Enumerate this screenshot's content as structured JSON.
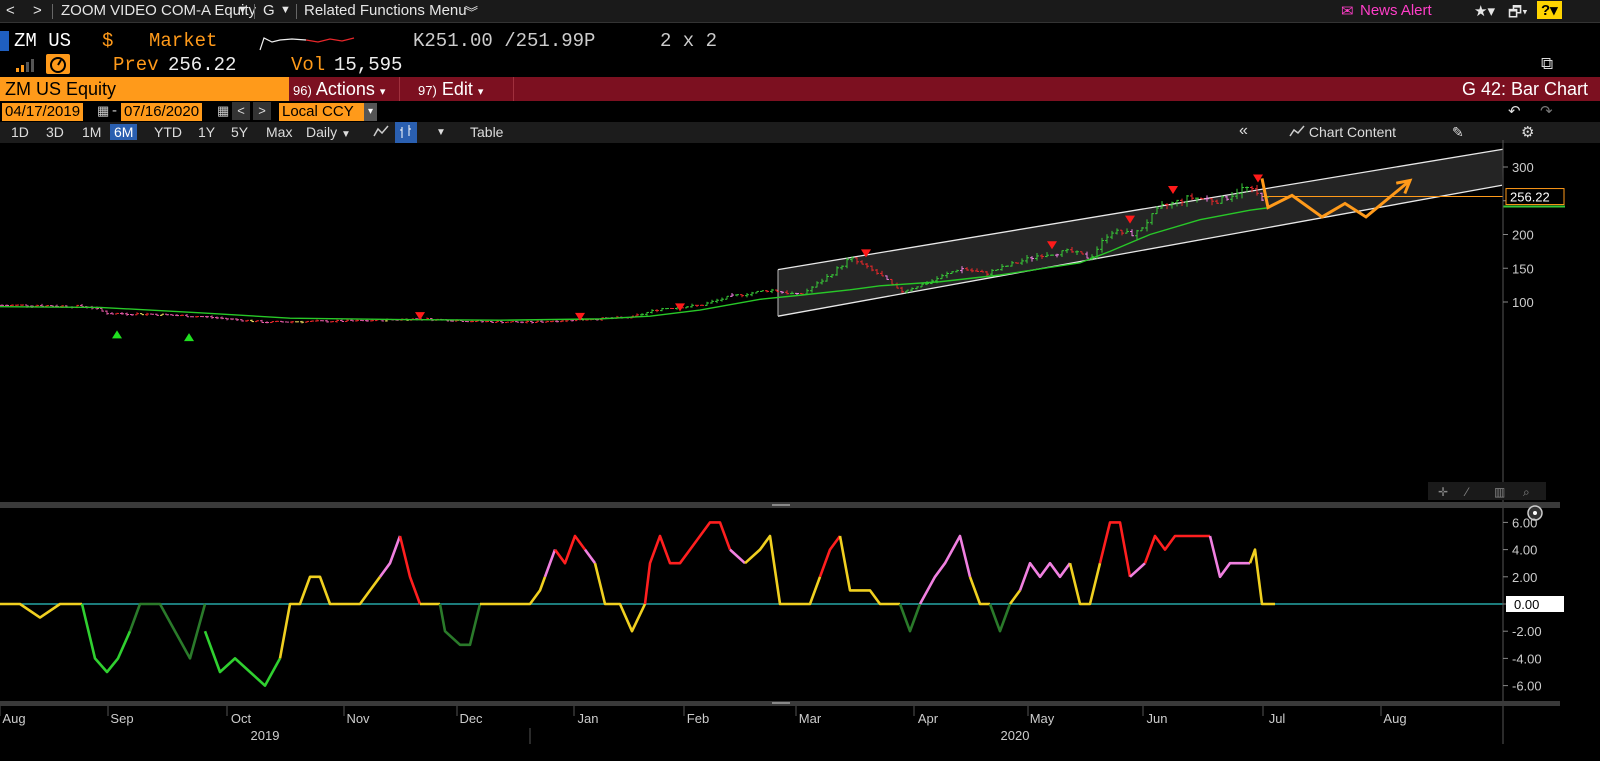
{
  "nav": {
    "back_glyph": "<",
    "forward_glyph": ">",
    "security": "ZOOM VIDEO COM-A Equity",
    "function": "G",
    "related": "Related Functions Menu",
    "news_alert": "News Alert"
  },
  "quote": {
    "ticker": "ZM US",
    "currency": "$",
    "mode": "Market",
    "bid_ask": "K251.00 /251.99P",
    "size": "2 x 2",
    "prev_label": "Prev",
    "prev_value": "256.22",
    "vol_label": "Vol",
    "vol_value": "15,595"
  },
  "command": {
    "security": "ZM US Equity",
    "actions_num": "96)",
    "actions": "Actions",
    "edit_num": "97)",
    "edit": "Edit",
    "chart_name": "G 42: Bar Chart"
  },
  "dates": {
    "start": "04/17/2019",
    "dash": "-",
    "end": "07/16/2020",
    "ccy": "Local CCY"
  },
  "toolbar": {
    "periods": [
      "1D",
      "3D",
      "1M",
      "6M",
      "YTD",
      "1Y",
      "5Y",
      "Max"
    ],
    "selected_period": "6M",
    "frequency": "Daily",
    "table": "Table",
    "chart_content": "Chart Content"
  },
  "icons": {
    "star": "star-icon",
    "alert": "bell-icon",
    "help": "help-icon",
    "gauge": "gauge-icon",
    "signal": "signal-icon",
    "undo": "undo-icon",
    "redo": "redo-icon",
    "settings": "gear-icon",
    "edit": "pencil-icon",
    "collapse": "chevron-double-left-icon",
    "expand": "expand-icon"
  },
  "colors": {
    "accent": "#ff9a1a",
    "command_bar": "#7c1020",
    "price_up": "#37c837",
    "price_down": "#e8272a",
    "ma_line": "#28c828",
    "osc_red": "#ff1f1f",
    "osc_yellow": "#f0d020",
    "osc_pink": "#f080e0",
    "osc_green": "#30d030",
    "osc_dark_green": "#2a7a2a",
    "zero_line": "#2ec5c5",
    "projection": "#ff9a1a"
  },
  "chart_data": [
    {
      "type": "bar",
      "title": "",
      "last_price": 256.22,
      "y_ticks": [
        100,
        150,
        200,
        250,
        300
      ],
      "y_tick_labels": [
        "100",
        "150",
        "200",
        "300"
      ],
      "ylim": [
        54,
        310
      ],
      "x_month_labels": [
        "Aug",
        "Sep",
        "Oct",
        "Nov",
        "Dec",
        "Jan",
        "Feb",
        "Mar",
        "Apr",
        "May",
        "Jun",
        "Jul",
        "Aug"
      ],
      "x_year_labels": [
        "2019",
        "2020"
      ],
      "price_path": [
        [
          0,
          95
        ],
        [
          35,
          95
        ],
        [
          60,
          94
        ],
        [
          90,
          93
        ],
        [
          108,
          83
        ],
        [
          150,
          82
        ],
        [
          205,
          78
        ],
        [
          265,
          70
        ],
        [
          300,
          71
        ],
        [
          360,
          72
        ],
        [
          420,
          75
        ],
        [
          480,
          71
        ],
        [
          530,
          70
        ],
        [
          580,
          74
        ],
        [
          630,
          77
        ],
        [
          660,
          90
        ],
        [
          700,
          95
        ],
        [
          730,
          108
        ],
        [
          770,
          118
        ],
        [
          800,
          110
        ],
        [
          830,
          140
        ],
        [
          850,
          165
        ],
        [
          880,
          140
        ],
        [
          900,
          115
        ],
        [
          930,
          130
        ],
        [
          960,
          150
        ],
        [
          985,
          142
        ],
        [
          1010,
          155
        ],
        [
          1040,
          170
        ],
        [
          1070,
          175
        ],
        [
          1090,
          165
        ],
        [
          1110,
          205
        ],
        [
          1135,
          200
        ],
        [
          1160,
          240
        ],
        [
          1190,
          255
        ],
        [
          1220,
          250
        ],
        [
          1245,
          270
        ],
        [
          1265,
          252
        ]
      ],
      "moving_average_path": [
        [
          0,
          93
        ],
        [
          100,
          92
        ],
        [
          200,
          84
        ],
        [
          290,
          76
        ],
        [
          400,
          74
        ],
        [
          500,
          73
        ],
        [
          600,
          75
        ],
        [
          650,
          79
        ],
        [
          700,
          88
        ],
        [
          760,
          104
        ],
        [
          800,
          110
        ],
        [
          850,
          118
        ],
        [
          880,
          124
        ],
        [
          940,
          130
        ],
        [
          1000,
          140
        ],
        [
          1080,
          158
        ],
        [
          1110,
          175
        ],
        [
          1150,
          200
        ],
        [
          1200,
          222
        ],
        [
          1250,
          236
        ],
        [
          1270,
          240
        ]
      ],
      "down_markers": [
        [
          420,
          79
        ],
        [
          580,
          78
        ],
        [
          680,
          92
        ],
        [
          866,
          172
        ],
        [
          1052,
          184
        ],
        [
          1130,
          222
        ],
        [
          1173,
          266
        ],
        [
          1258,
          283
        ]
      ],
      "up_markers": [
        [
          117,
          52
        ],
        [
          189,
          48
        ]
      ],
      "channel": {
        "upper": [
          [
            778,
            148
          ],
          [
            1404,
            302
          ]
        ],
        "lower": [
          [
            778,
            79
          ],
          [
            1502,
            273
          ]
        ]
      },
      "projection_path": [
        [
          1262,
          283
        ],
        [
          1268,
          240
        ],
        [
          1292,
          258
        ],
        [
          1322,
          226
        ],
        [
          1345,
          246
        ],
        [
          1366,
          226
        ],
        [
          1410,
          280
        ]
      ]
    },
    {
      "type": "line",
      "title": "",
      "y_tick_labels": [
        "6.00",
        "4.00",
        "2.00",
        "0.00",
        "-2.00",
        "-4.00",
        "-6.00"
      ],
      "last_value": "0.00",
      "ylim": [
        -7,
        7
      ],
      "series_segments": [
        {
          "color": "yellow",
          "points": [
            [
              0,
              0
            ],
            [
              20,
              0
            ],
            [
              40,
              -1
            ],
            [
              60,
              0
            ],
            [
              82,
              0
            ]
          ]
        },
        {
          "color": "green",
          "points": [
            [
              82,
              0
            ],
            [
              95,
              -4
            ],
            [
              107,
              -5
            ],
            [
              118,
              -4
            ],
            [
              130,
              -2
            ]
          ]
        },
        {
          "color": "dark_green",
          "points": [
            [
              130,
              -2
            ],
            [
              140,
              0
            ],
            [
              160,
              0
            ],
            [
              175,
              -2
            ],
            [
              190,
              -4
            ],
            [
              205,
              0
            ]
          ]
        },
        {
          "color": "green",
          "points": [
            [
              205,
              -2
            ],
            [
              220,
              -5
            ],
            [
              235,
              -4
            ],
            [
              250,
              -5
            ],
            [
              265,
              -6
            ],
            [
              280,
              -4
            ]
          ]
        },
        {
          "color": "yellow",
          "points": [
            [
              280,
              -4
            ],
            [
              290,
              0
            ],
            [
              300,
              0
            ],
            [
              310,
              2
            ],
            [
              320,
              2
            ],
            [
              330,
              0
            ],
            [
              360,
              0
            ],
            [
              370,
              1
            ],
            [
              380,
              2
            ]
          ]
        },
        {
          "color": "pink",
          "points": [
            [
              380,
              2
            ],
            [
              390,
              3
            ],
            [
              400,
              5
            ]
          ]
        },
        {
          "color": "red",
          "points": [
            [
              400,
              5
            ],
            [
              410,
              2
            ],
            [
              420,
              0
            ]
          ]
        },
        {
          "color": "yellow",
          "points": [
            [
              420,
              0
            ],
            [
              440,
              0
            ]
          ]
        },
        {
          "color": "dark_green",
          "points": [
            [
              440,
              0
            ],
            [
              445,
              -2
            ],
            [
              460,
              -3
            ],
            [
              470,
              -3
            ],
            [
              480,
              0
            ]
          ]
        },
        {
          "color": "yellow",
          "points": [
            [
              480,
              0
            ],
            [
              530,
              0
            ],
            [
              540,
              1
            ],
            [
              545,
              2
            ]
          ]
        },
        {
          "color": "pink",
          "points": [
            [
              545,
              2
            ],
            [
              555,
              4
            ]
          ]
        },
        {
          "color": "red",
          "points": [
            [
              555,
              4
            ],
            [
              565,
              3
            ],
            [
              575,
              5
            ],
            [
              585,
              4
            ]
          ]
        },
        {
          "color": "pink",
          "points": [
            [
              585,
              4
            ],
            [
              595,
              3
            ]
          ]
        },
        {
          "color": "yellow",
          "points": [
            [
              595,
              3
            ],
            [
              605,
              0
            ],
            [
              620,
              0
            ],
            [
              632,
              -2
            ],
            [
              645,
              0
            ]
          ]
        },
        {
          "color": "red",
          "points": [
            [
              645,
              0
            ],
            [
              650,
              3
            ],
            [
              660,
              5
            ],
            [
              670,
              3
            ],
            [
              680,
              3
            ],
            [
              690,
              4
            ],
            [
              700,
              5
            ],
            [
              710,
              6
            ],
            [
              720,
              6
            ],
            [
              730,
              4
            ]
          ]
        },
        {
          "color": "pink",
          "points": [
            [
              730,
              4
            ],
            [
              745,
              3
            ]
          ]
        },
        {
          "color": "yellow",
          "points": [
            [
              745,
              3
            ],
            [
              760,
              4
            ],
            [
              770,
              5
            ],
            [
              780,
              0
            ],
            [
              810,
              0
            ],
            [
              820,
              2
            ]
          ]
        },
        {
          "color": "red",
          "points": [
            [
              820,
              2
            ],
            [
              830,
              4
            ],
            [
              840,
              5
            ]
          ]
        },
        {
          "color": "yellow",
          "points": [
            [
              840,
              5
            ],
            [
              850,
              1
            ],
            [
              870,
              1
            ],
            [
              880,
              0
            ],
            [
              900,
              0
            ]
          ]
        },
        {
          "color": "dark_green",
          "points": [
            [
              900,
              0
            ],
            [
              910,
              -2
            ],
            [
              920,
              0
            ]
          ]
        },
        {
          "color": "pink",
          "points": [
            [
              920,
              0
            ],
            [
              935,
              2
            ],
            [
              945,
              3
            ],
            [
              960,
              5
            ],
            [
              970,
              2
            ]
          ]
        },
        {
          "color": "yellow",
          "points": [
            [
              970,
              2
            ],
            [
              980,
              0
            ],
            [
              990,
              0
            ]
          ]
        },
        {
          "color": "dark_green",
          "points": [
            [
              990,
              0
            ],
            [
              1000,
              -2
            ],
            [
              1010,
              0
            ]
          ]
        },
        {
          "color": "yellow",
          "points": [
            [
              1010,
              0
            ],
            [
              1020,
              1
            ]
          ]
        },
        {
          "color": "pink",
          "points": [
            [
              1020,
              1
            ],
            [
              1030,
              3
            ],
            [
              1040,
              2
            ],
            [
              1050,
              3
            ],
            [
              1060,
              2
            ],
            [
              1070,
              3
            ]
          ]
        },
        {
          "color": "yellow",
          "points": [
            [
              1070,
              3
            ],
            [
              1080,
              0
            ],
            [
              1090,
              0
            ],
            [
              1100,
              3
            ]
          ]
        },
        {
          "color": "red",
          "points": [
            [
              1100,
              3
            ],
            [
              1110,
              6
            ],
            [
              1120,
              6
            ],
            [
              1130,
              2
            ]
          ]
        },
        {
          "color": "pink",
          "points": [
            [
              1130,
              2
            ],
            [
              1145,
              3
            ]
          ]
        },
        {
          "color": "red",
          "points": [
            [
              1145,
              3
            ],
            [
              1155,
              5
            ],
            [
              1165,
              4
            ],
            [
              1175,
              5
            ],
            [
              1210,
              5
            ]
          ]
        },
        {
          "color": "pink",
          "points": [
            [
              1210,
              5
            ],
            [
              1220,
              2
            ],
            [
              1230,
              3
            ],
            [
              1250,
              3
            ]
          ]
        },
        {
          "color": "yellow",
          "points": [
            [
              1250,
              3
            ],
            [
              1255,
              4
            ],
            [
              1262,
              0
            ],
            [
              1275,
              0
            ]
          ]
        }
      ]
    }
  ]
}
